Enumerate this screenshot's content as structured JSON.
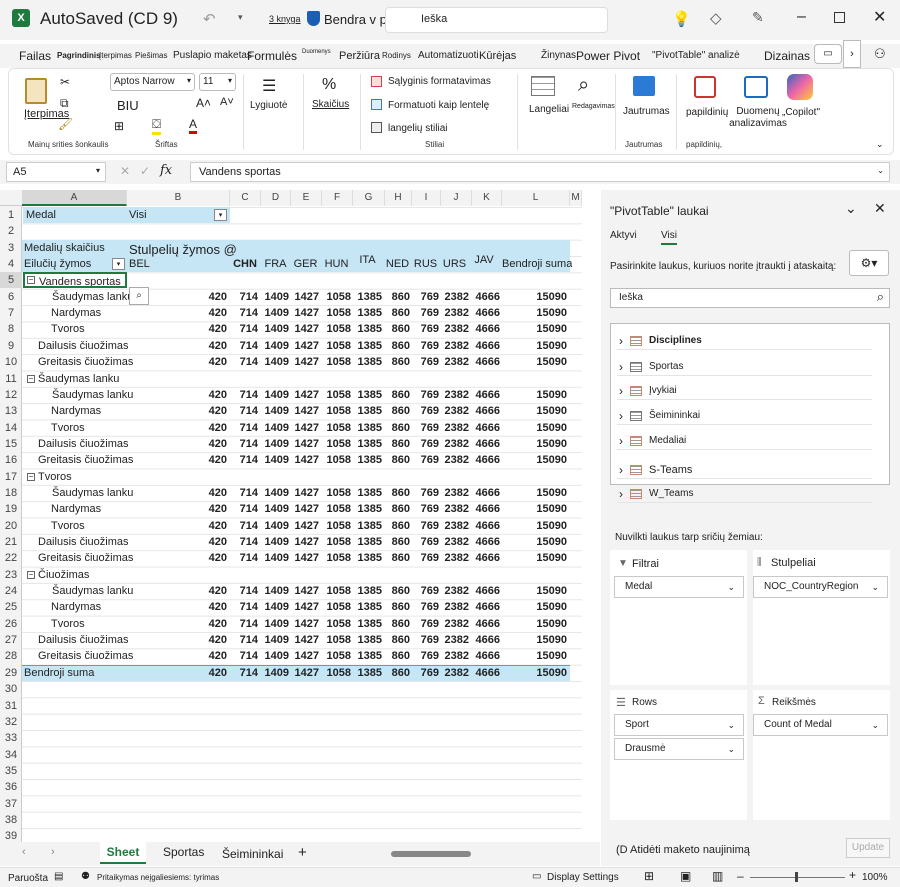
{
  "titlebar": {
    "app_title": "AutoSaved (CD 9)",
    "book_label": "3 knyga",
    "shared_label": "Bendra v p",
    "search_placeholder": "Ieška"
  },
  "menu": {
    "tabs": [
      "Failas",
      "Pagrindinis",
      "Įterpimas",
      "Piešimas",
      "Puslapio maketas",
      "Formulės",
      "Duomenys",
      "Peržiūra",
      "Rodinys",
      "Automatizuoti",
      "Kūrėjas",
      "Žinynas",
      "Power Pivot",
      "\"PivotTable\" analizė",
      "Dizainas"
    ]
  },
  "ribbon": {
    "paste_label": "Įterpimas",
    "font_name": "Aptos Narrow",
    "font_size": "11",
    "bold_italic_underline": "BIU",
    "alignment_label": "Lygiuotė",
    "number_label": "Skaičius",
    "conditional_label": "Sąlyginis formatavimas",
    "format_table_label": "Formatuoti kaip lentelę",
    "cell_styles_label": "langelių stiliai",
    "cells_label": "Langeliai",
    "editing_label": "Redagavimas",
    "powers_label": "Jautrumas",
    "addins_label": "papildinių",
    "analyze_label": "Duomenų analizavimas",
    "copilot_label": "„Copilot\"",
    "group_clipboard": "Mainų srities šonkaulis",
    "group_font": "Šriftas",
    "group_styles": "Stiliai",
    "group_sensitivity": "Jautrumas",
    "group_addins": "papildinių,"
  },
  "formula_bar": {
    "name_box": "A5",
    "fx": "fx",
    "content": "Vandens sportas"
  },
  "grid": {
    "columns": [
      "A",
      "B",
      "C",
      "D",
      "E",
      "F",
      "G",
      "H",
      "I",
      "J",
      "K",
      "L",
      "M"
    ],
    "row_numbers": [
      "1",
      "2",
      "3",
      "4",
      "5",
      "6",
      "7",
      "8",
      "9",
      "10",
      "11",
      "12",
      "13",
      "14",
      "15",
      "16",
      "17",
      "18",
      "19",
      "20",
      "21",
      "22",
      "23",
      "24",
      "25",
      "26",
      "27",
      "28",
      "29",
      "30",
      "31",
      "32",
      "33",
      "34",
      "35",
      "36",
      "37",
      "38",
      "39"
    ],
    "filter_label": "Medal",
    "filter_value": "Visi",
    "values_label": "Medalių skaičius",
    "col_labels_title": "Stulpelių žymos @",
    "row_labels_title": "Eilučių žymos",
    "countries": [
      "BEL",
      "CHN",
      "FRA",
      "GER",
      "HUN",
      "ITA",
      "NED",
      "RUS",
      "URS",
      "JAV",
      "Bendroji suma"
    ],
    "values": [
      "420",
      "714",
      "1409",
      "1427",
      "1058",
      "1385",
      "860",
      "769",
      "2382",
      "4666",
      "15090"
    ],
    "groups": [
      {
        "name": "Vandens sportas",
        "items": [
          "Šaudymas lanku",
          "Nardymas",
          "Tvoros",
          "Dailusis čiuožimas",
          "Greitasis čiuožimas"
        ]
      },
      {
        "name": "Šaudymas lanku",
        "items": [
          "Šaudymas lanku",
          "Nardymas",
          "Tvoros",
          "Dailusis čiuožimas",
          "Greitasis čiuožimas"
        ]
      },
      {
        "name": "Tvoros",
        "items": [
          "Šaudymas lanku",
          "Nardymas",
          "Tvoros",
          "Dailusis čiuožimas",
          "Greitasis čiuožimas"
        ]
      },
      {
        "name": "Čiuožimas",
        "items": [
          "Šaudymas lanku",
          "Nardymas",
          "Tvoros",
          "Dailusis čiuožimas",
          "Greitasis čiuožimas"
        ]
      }
    ],
    "total_label": "Bendroji suma"
  },
  "sheet_tabs": [
    "Sheet",
    "Sportas",
    "Šeimininkai"
  ],
  "status": {
    "ready": "Paruošta",
    "accessibility": "Pritaikymas neįgaliesiems: tyrimas",
    "display_settings": "Display Settings",
    "zoom": "100%"
  },
  "pane": {
    "title": "\"PivotTable\" laukai",
    "tab_active": "Aktyvi",
    "tab_all": "Visi",
    "instruction": "Pasirinkite laukus, kuriuos norite įtraukti į ataskaitą:",
    "search_placeholder": "Ieška",
    "fields": [
      "Disciplines",
      "Sportas",
      "Įvykiai",
      "Šeimininkai",
      "Medaliai",
      "S-Teams",
      "W_Teams"
    ],
    "drag_label": "Nuvilkti laukus tarp sričių žemiau:",
    "filters_label": "Filtrai",
    "columns_label": "Stulpeliai",
    "rows_label": "Rows",
    "values_label": "Reikšmės",
    "filter_field": "Medal",
    "column_field": "NOC_CountryRegion",
    "row_fields": [
      "Sport",
      "Drausmė"
    ],
    "value_field": "Count of Medal",
    "defer_label": "(D Atidėti maketo naujinimą",
    "update_label": "Update"
  },
  "colors": {
    "pivot_header": "#c6e6f5",
    "accent": "#1f7a3e",
    "bg": "#f3f3f3"
  }
}
